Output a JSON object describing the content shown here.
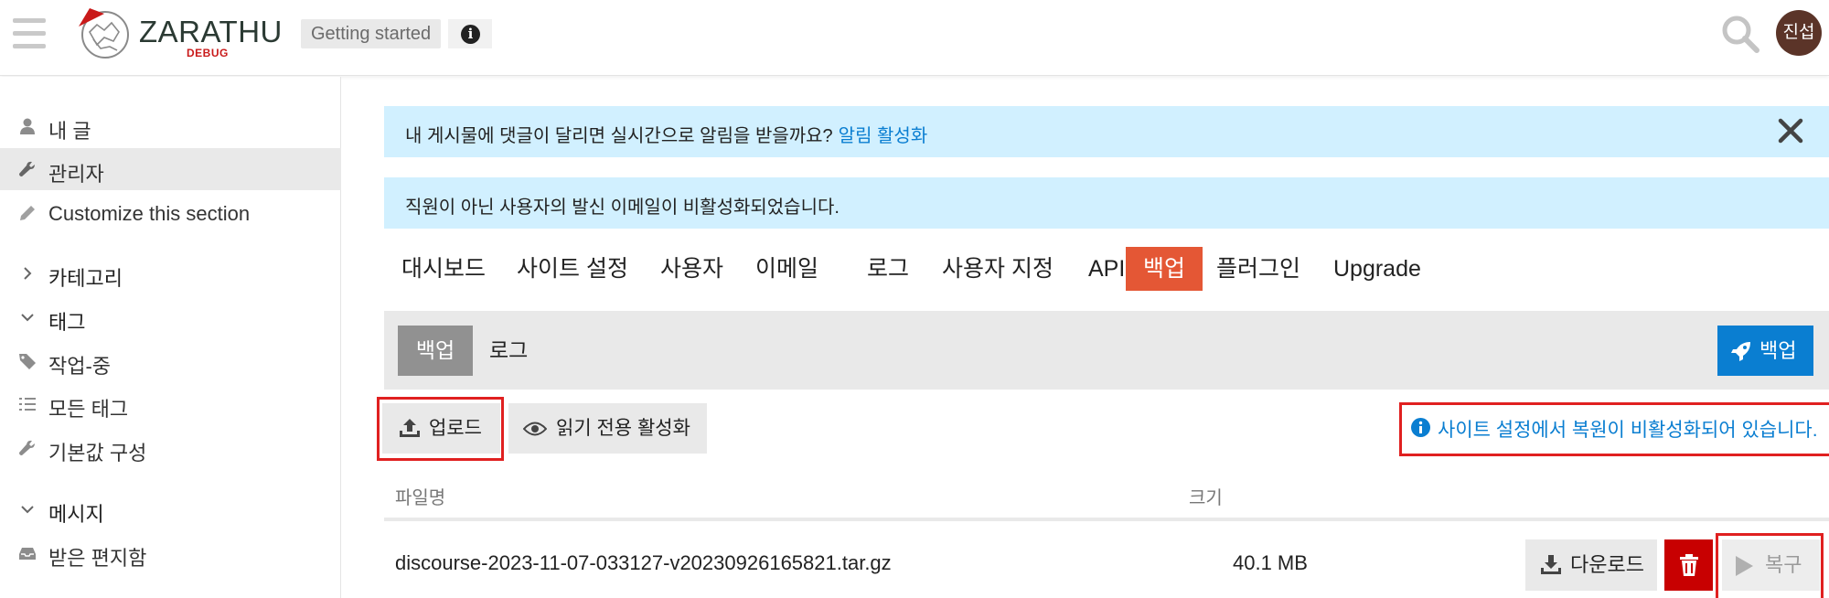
{
  "header": {
    "logo_text": "ZARATHU",
    "logo_sub": "DEBUG",
    "getting_started": "Getting started",
    "avatar_initials": "진섭"
  },
  "sidebar": {
    "items": [
      {
        "label": "내 글",
        "icon": "user-icon"
      },
      {
        "label": "관리자",
        "icon": "wrench-icon"
      },
      {
        "label": "Customize this section",
        "icon": "pencil-icon"
      }
    ],
    "categories_label": "카테고리",
    "tags_label": "태그",
    "tags": [
      {
        "label": "작업-중",
        "icon": "tag-icon"
      },
      {
        "label": "모든 태그",
        "icon": "list-icon"
      },
      {
        "label": "기본값 구성",
        "icon": "wrench-icon"
      }
    ],
    "messages_label": "메시지",
    "inbox_label": "받은 편지함"
  },
  "banners": {
    "notify_text": "내 게시물에 댓글이 달리면 실시간으로 알림을 받을까요?",
    "notify_link": "알림 활성화",
    "email_notice": "직원이 아닌 사용자의 발신 이메일이 비활성화되었습니다."
  },
  "admin_nav": {
    "tabs": [
      "대시보드",
      "사이트 설정",
      "사용자",
      "이메일",
      "로그",
      "사용자 지정",
      "API",
      "백업",
      "플러그인",
      "Upgrade"
    ],
    "active": "백업"
  },
  "backup_subnav": {
    "backups_label": "백업",
    "logs_label": "로그",
    "backup_button": "백업"
  },
  "actions": {
    "upload_label": "업로드",
    "readonly_label": "읽기 전용 활성화",
    "restore_disabled_note": "사이트 설정에서 복원이 비활성화되어 있습니다."
  },
  "table": {
    "columns": [
      "파일명",
      "크기"
    ],
    "rows": [
      {
        "filename": "discourse-2023-11-07-033127-v20230926165821.tar.gz",
        "size": "40.1 MB"
      }
    ],
    "download_label": "다운로드",
    "restore_label": "복구"
  },
  "colors": {
    "accent": "#e45735",
    "primary_blue": "#0a7ed1",
    "banner_bg": "#d1f0ff",
    "danger": "#c80001",
    "highlight_box": "#e02020"
  }
}
